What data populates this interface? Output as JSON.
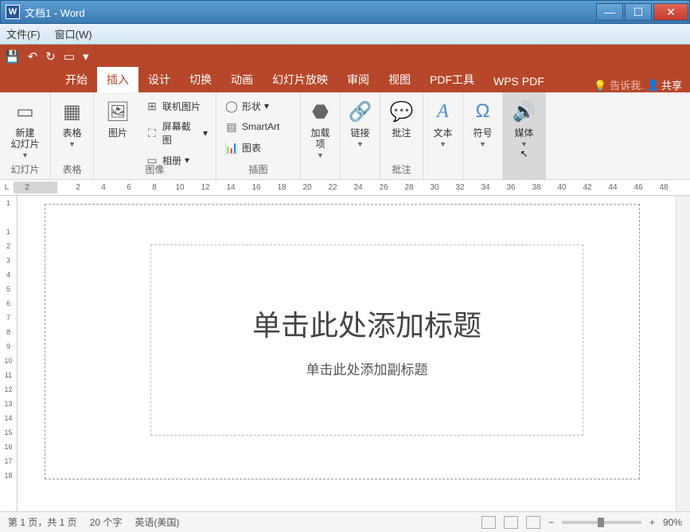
{
  "titlebar": {
    "title": "文档1 - Word"
  },
  "menubar": {
    "file": "文件(F)",
    "window": "窗口(W)"
  },
  "tabs": {
    "start": "开始",
    "insert": "插入",
    "design": "设计",
    "transition": "切换",
    "anim": "动画",
    "slideshow": "幻灯片放映",
    "review": "审阅",
    "view": "视图",
    "pdftools": "PDF工具",
    "wpspdf": "WPS PDF",
    "tell": "告诉我.",
    "share": "共享"
  },
  "ribbon": {
    "newslide": "新建\n幻灯片",
    "slides_group": "幻灯片",
    "table": "表格",
    "table_group": "表格",
    "picture": "图片",
    "online_pic": "联机图片",
    "screenshot": "屏幕截图",
    "album": "相册",
    "images_group": "图像",
    "shapes": "形状",
    "smartart": "SmartArt",
    "chart": "图表",
    "illus_group": "插图",
    "addins": "加载\n项",
    "links": "链接",
    "comment": "批注",
    "comment_group": "批注",
    "text": "文本",
    "symbol": "符号",
    "media": "媒体"
  },
  "ruler_h": [
    "2",
    "",
    "2",
    "4",
    "6",
    "8",
    "10",
    "12",
    "14",
    "16",
    "18",
    "20",
    "22",
    "24",
    "26",
    "28",
    "30",
    "32",
    "34",
    "36",
    "38",
    "40",
    "42",
    "44",
    "46",
    "48"
  ],
  "ruler_v": [
    "1",
    "",
    "1",
    "2",
    "3",
    "4",
    "5",
    "6",
    "7",
    "8",
    "9",
    "10",
    "11",
    "12",
    "13",
    "14",
    "15",
    "16",
    "17",
    "18"
  ],
  "placeholders": {
    "title": "单击此处添加标题",
    "subtitle": "单击此处添加副标题"
  },
  "status": {
    "page": "第 1 页，共 1 页",
    "words": "20 个字",
    "lang": "英语(美国)",
    "zoom": "90%"
  }
}
